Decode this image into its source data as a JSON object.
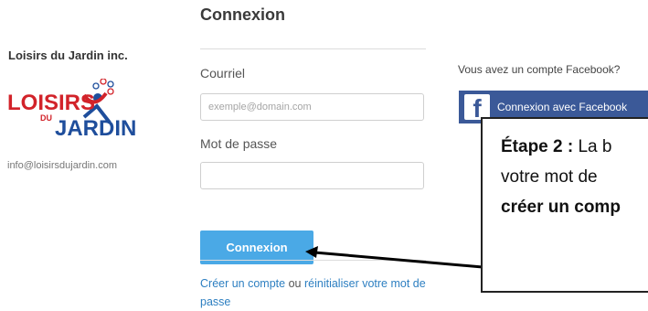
{
  "organization": {
    "name": "Loisirs du Jardin inc.",
    "logo_top": "LOISIRS",
    "logo_du": "DU",
    "logo_bottom": "JARDIN",
    "email": "info@loisirsdujardin.com"
  },
  "login": {
    "title": "Connexion",
    "email_label": "Courriel",
    "email_placeholder": "exemple@domain.com",
    "password_label": "Mot de passe",
    "submit_label": "Connexion",
    "create_account_link": "Créer un compte",
    "or_text": "ou",
    "reset_password_link": "réinitialiser votre mot de passe"
  },
  "facebook": {
    "question": "Vous avez un compte Facebook?",
    "button_label": "Connexion avec Facebook",
    "icon_glyph": "f"
  },
  "annotation": {
    "step_label": "Étape 2 :",
    "line1_rest": "La b",
    "line2": "votre mot de",
    "line3": "créer un comp"
  },
  "colors": {
    "accent": "#4aa9e6",
    "facebook": "#3b5998",
    "link": "#2d7fc1",
    "logo_red": "#d2232a",
    "logo_blue": "#1f4e9c"
  }
}
